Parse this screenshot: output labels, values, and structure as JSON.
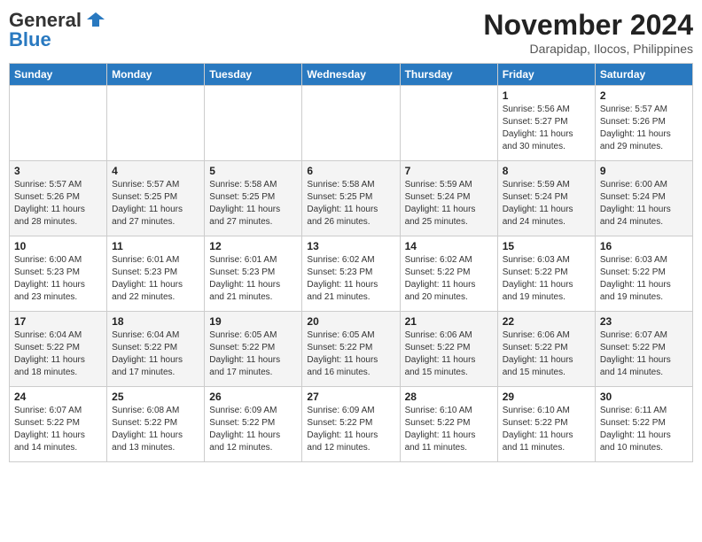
{
  "header": {
    "logo_line1": "General",
    "logo_line2": "Blue",
    "month": "November 2024",
    "location": "Darapidap, Ilocos, Philippines"
  },
  "weekdays": [
    "Sunday",
    "Monday",
    "Tuesday",
    "Wednesday",
    "Thursday",
    "Friday",
    "Saturday"
  ],
  "weeks": [
    [
      {
        "day": "",
        "info": ""
      },
      {
        "day": "",
        "info": ""
      },
      {
        "day": "",
        "info": ""
      },
      {
        "day": "",
        "info": ""
      },
      {
        "day": "",
        "info": ""
      },
      {
        "day": "1",
        "info": "Sunrise: 5:56 AM\nSunset: 5:27 PM\nDaylight: 11 hours and 30 minutes."
      },
      {
        "day": "2",
        "info": "Sunrise: 5:57 AM\nSunset: 5:26 PM\nDaylight: 11 hours and 29 minutes."
      }
    ],
    [
      {
        "day": "3",
        "info": "Sunrise: 5:57 AM\nSunset: 5:26 PM\nDaylight: 11 hours and 28 minutes."
      },
      {
        "day": "4",
        "info": "Sunrise: 5:57 AM\nSunset: 5:25 PM\nDaylight: 11 hours and 27 minutes."
      },
      {
        "day": "5",
        "info": "Sunrise: 5:58 AM\nSunset: 5:25 PM\nDaylight: 11 hours and 27 minutes."
      },
      {
        "day": "6",
        "info": "Sunrise: 5:58 AM\nSunset: 5:25 PM\nDaylight: 11 hours and 26 minutes."
      },
      {
        "day": "7",
        "info": "Sunrise: 5:59 AM\nSunset: 5:24 PM\nDaylight: 11 hours and 25 minutes."
      },
      {
        "day": "8",
        "info": "Sunrise: 5:59 AM\nSunset: 5:24 PM\nDaylight: 11 hours and 24 minutes."
      },
      {
        "day": "9",
        "info": "Sunrise: 6:00 AM\nSunset: 5:24 PM\nDaylight: 11 hours and 24 minutes."
      }
    ],
    [
      {
        "day": "10",
        "info": "Sunrise: 6:00 AM\nSunset: 5:23 PM\nDaylight: 11 hours and 23 minutes."
      },
      {
        "day": "11",
        "info": "Sunrise: 6:01 AM\nSunset: 5:23 PM\nDaylight: 11 hours and 22 minutes."
      },
      {
        "day": "12",
        "info": "Sunrise: 6:01 AM\nSunset: 5:23 PM\nDaylight: 11 hours and 21 minutes."
      },
      {
        "day": "13",
        "info": "Sunrise: 6:02 AM\nSunset: 5:23 PM\nDaylight: 11 hours and 21 minutes."
      },
      {
        "day": "14",
        "info": "Sunrise: 6:02 AM\nSunset: 5:22 PM\nDaylight: 11 hours and 20 minutes."
      },
      {
        "day": "15",
        "info": "Sunrise: 6:03 AM\nSunset: 5:22 PM\nDaylight: 11 hours and 19 minutes."
      },
      {
        "day": "16",
        "info": "Sunrise: 6:03 AM\nSunset: 5:22 PM\nDaylight: 11 hours and 19 minutes."
      }
    ],
    [
      {
        "day": "17",
        "info": "Sunrise: 6:04 AM\nSunset: 5:22 PM\nDaylight: 11 hours and 18 minutes."
      },
      {
        "day": "18",
        "info": "Sunrise: 6:04 AM\nSunset: 5:22 PM\nDaylight: 11 hours and 17 minutes."
      },
      {
        "day": "19",
        "info": "Sunrise: 6:05 AM\nSunset: 5:22 PM\nDaylight: 11 hours and 17 minutes."
      },
      {
        "day": "20",
        "info": "Sunrise: 6:05 AM\nSunset: 5:22 PM\nDaylight: 11 hours and 16 minutes."
      },
      {
        "day": "21",
        "info": "Sunrise: 6:06 AM\nSunset: 5:22 PM\nDaylight: 11 hours and 15 minutes."
      },
      {
        "day": "22",
        "info": "Sunrise: 6:06 AM\nSunset: 5:22 PM\nDaylight: 11 hours and 15 minutes."
      },
      {
        "day": "23",
        "info": "Sunrise: 6:07 AM\nSunset: 5:22 PM\nDaylight: 11 hours and 14 minutes."
      }
    ],
    [
      {
        "day": "24",
        "info": "Sunrise: 6:07 AM\nSunset: 5:22 PM\nDaylight: 11 hours and 14 minutes."
      },
      {
        "day": "25",
        "info": "Sunrise: 6:08 AM\nSunset: 5:22 PM\nDaylight: 11 hours and 13 minutes."
      },
      {
        "day": "26",
        "info": "Sunrise: 6:09 AM\nSunset: 5:22 PM\nDaylight: 11 hours and 12 minutes."
      },
      {
        "day": "27",
        "info": "Sunrise: 6:09 AM\nSunset: 5:22 PM\nDaylight: 11 hours and 12 minutes."
      },
      {
        "day": "28",
        "info": "Sunrise: 6:10 AM\nSunset: 5:22 PM\nDaylight: 11 hours and 11 minutes."
      },
      {
        "day": "29",
        "info": "Sunrise: 6:10 AM\nSunset: 5:22 PM\nDaylight: 11 hours and 11 minutes."
      },
      {
        "day": "30",
        "info": "Sunrise: 6:11 AM\nSunset: 5:22 PM\nDaylight: 11 hours and 10 minutes."
      }
    ]
  ]
}
